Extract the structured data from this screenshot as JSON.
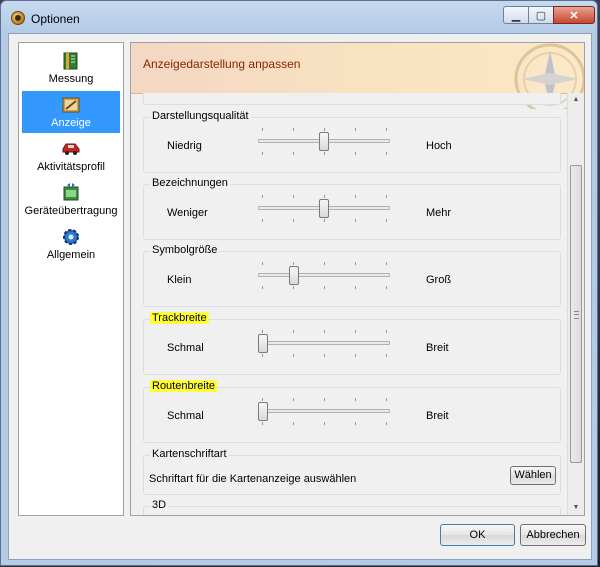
{
  "window": {
    "title": "Optionen",
    "controls": {
      "minimize": "▁",
      "maximize": "▢",
      "close": "✕"
    }
  },
  "sidebar": {
    "items": [
      {
        "label": "Messung",
        "icon": "ruler-book-icon",
        "active": false
      },
      {
        "label": "Anzeige",
        "icon": "display-pencil-icon",
        "active": true
      },
      {
        "label": "Aktivitätsprofil",
        "icon": "car-bike-icon",
        "active": false
      },
      {
        "label": "Geräteübertragung",
        "icon": "device-transfer-icon",
        "active": false
      },
      {
        "label": "Allgemein",
        "icon": "gear-icon",
        "active": false
      }
    ]
  },
  "main": {
    "header_title": "Anzeigedarstellung anpassen",
    "groups": [
      {
        "title": "Darstellungsqualität",
        "left": "Niedrig",
        "right": "Hoch",
        "value": 0.5,
        "highlight": false
      },
      {
        "title": "Bezeichnungen",
        "left": "Weniger",
        "right": "Mehr",
        "value": 0.5,
        "highlight": false
      },
      {
        "title": "Symbolgröße",
        "left": "Klein",
        "right": "Groß",
        "value": 0.25,
        "highlight": false
      },
      {
        "title": "Trackbreite",
        "left": "Schmal",
        "right": "Breit",
        "value": 0.0,
        "highlight": true
      },
      {
        "title": "Routenbreite",
        "left": "Schmal",
        "right": "Breit",
        "value": 0.0,
        "highlight": true
      }
    ],
    "font_group": {
      "title": "Kartenschriftart",
      "description": "Schriftart für die Kartenanzeige auswählen",
      "button": "Wählen"
    },
    "three_d_group": {
      "title": "3D"
    }
  },
  "footer": {
    "ok": "OK",
    "cancel": "Abbrechen"
  },
  "colors": {
    "accent_selection": "#3399ff",
    "header_title": "#8b2500",
    "highlight": "#ffff33"
  }
}
